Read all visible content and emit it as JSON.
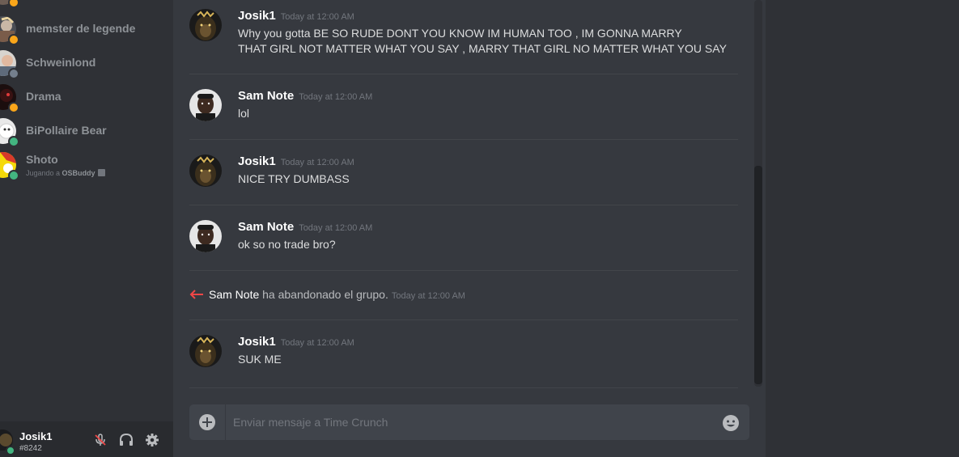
{
  "members": [
    {
      "name": "memster de legende",
      "status": "idle",
      "activity_prefix": "",
      "activity_app": ""
    },
    {
      "name": "Schweinlond",
      "status": "offline",
      "activity_prefix": "",
      "activity_app": ""
    },
    {
      "name": "Drama",
      "status": "idle",
      "activity_prefix": "",
      "activity_app": ""
    },
    {
      "name": "BiPollaire Bear",
      "status": "online",
      "activity_prefix": "",
      "activity_app": ""
    },
    {
      "name": "Shoto",
      "status": "online",
      "activity_prefix": "Jugando a ",
      "activity_app": "OSBuddy"
    }
  ],
  "user_panel": {
    "username": "Josik1",
    "tag": "#8242",
    "mic_icon": "muted-microphone-icon",
    "headphones_icon": "headphones-icon",
    "settings_icon": "gear-icon"
  },
  "messages": [
    {
      "author": "Josik1",
      "time": "Today at 12:00 AM",
      "lines": [
        "Why you gotta BE SO RUDE DONT YOU KNOW IM HUMAN TOO , IM GONNA MARRY",
        "THAT GIRL NOT MATTER WHAT YOU SAY , MARRY THAT GIRL NO MATTER WHAT YOU SAY"
      ]
    },
    {
      "author": "Sam Note",
      "time": "Today at 12:00 AM",
      "lines": [
        "lol"
      ]
    },
    {
      "author": "Josik1",
      "time": "Today at 12:00 AM",
      "lines": [
        "NICE TRY DUMBASS"
      ]
    },
    {
      "author": "Sam Note",
      "time": "Today at 12:00 AM",
      "lines": [
        "ok so no trade bro?"
      ]
    },
    {
      "author": "Josik1",
      "time": "Today at 12:00 AM",
      "lines": [
        "SUK ME"
      ]
    }
  ],
  "system_message": {
    "user": "Sam Note",
    "text": " ha abandonado el grupo.",
    "time": "Today at 12:00 AM"
  },
  "composer": {
    "placeholder": "Enviar mensaje a Time Crunch"
  },
  "colors": {
    "online": "#43b581",
    "idle": "#faa61a",
    "offline": "#747f8d",
    "leave_arrow": "#f04747"
  }
}
